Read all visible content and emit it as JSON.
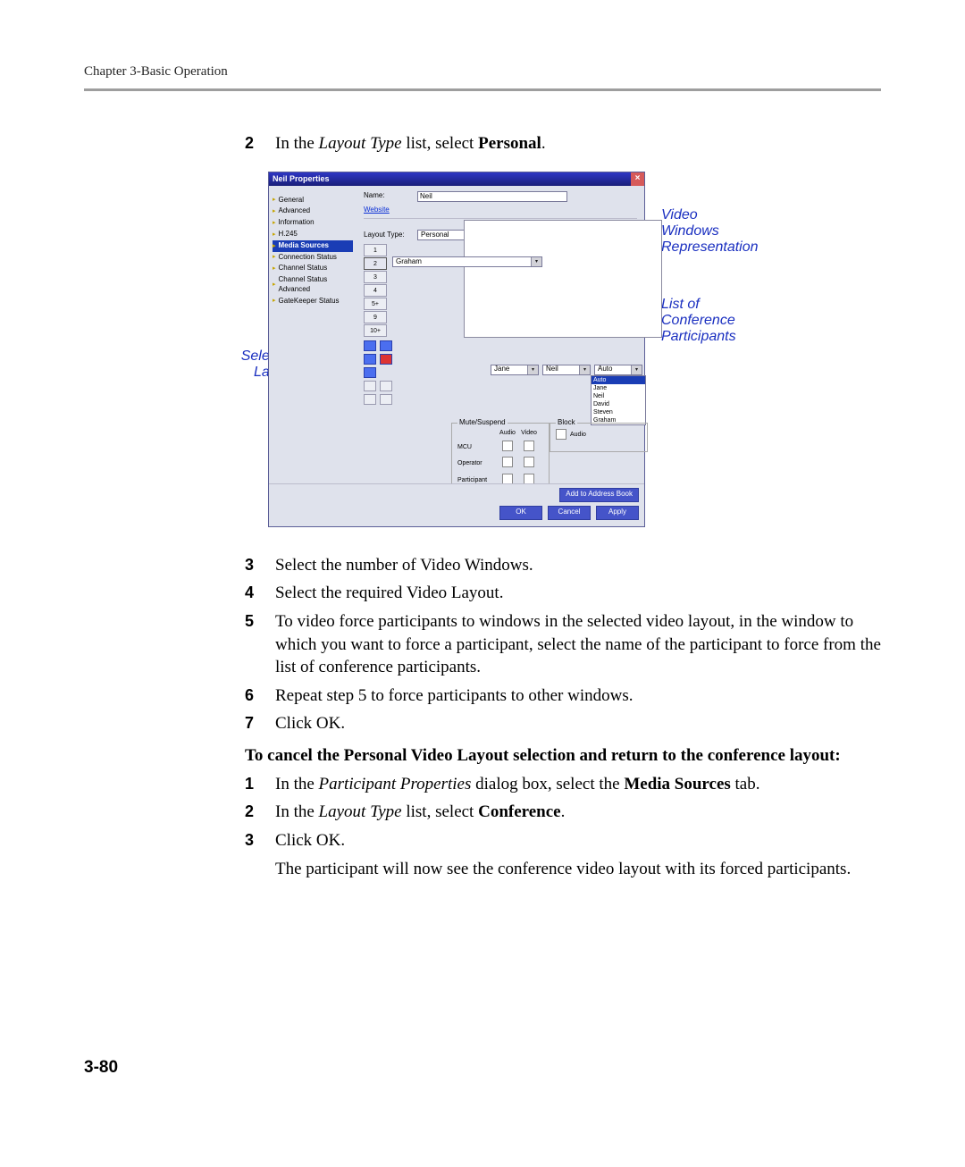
{
  "header": "Chapter 3-Basic Operation",
  "page_number": "3-80",
  "steps_a": [
    {
      "n": "2",
      "parts": [
        {
          "t": "In the "
        },
        {
          "t": "Layout Type",
          "cls": "it"
        },
        {
          "t": " list, select "
        },
        {
          "t": "Personal",
          "cls": "bd"
        },
        {
          "t": "."
        }
      ]
    }
  ],
  "steps_b": [
    {
      "n": "3",
      "parts": [
        {
          "t": "Select the number of Video Windows."
        }
      ]
    },
    {
      "n": "4",
      "parts": [
        {
          "t": "Select the required Video Layout."
        }
      ]
    },
    {
      "n": "5",
      "parts": [
        {
          "t": "To video force participants to windows in the selected video layout, in the window to which you want to force a participant, select the name of the participant to force from the list of conference participants."
        }
      ]
    },
    {
      "n": "6",
      "parts": [
        {
          "t": "Repeat step 5 to force participants to other windows."
        }
      ]
    },
    {
      "n": "7",
      "parts": [
        {
          "t": "Click OK."
        }
      ]
    }
  ],
  "subhead": "To cancel the Personal Video Layout selection and return to the conference layout:",
  "steps_c": [
    {
      "n": "1",
      "parts": [
        {
          "t": "In the "
        },
        {
          "t": "Participant Properties",
          "cls": "it"
        },
        {
          "t": " dialog box, select the "
        },
        {
          "t": "Media Sources",
          "cls": "bd"
        },
        {
          "t": " tab."
        }
      ]
    },
    {
      "n": "2",
      "parts": [
        {
          "t": "In the "
        },
        {
          "t": "Layout Type",
          "cls": "it"
        },
        {
          "t": " list, select "
        },
        {
          "t": "Conference",
          "cls": "bd"
        },
        {
          "t": "."
        }
      ]
    },
    {
      "n": "3",
      "parts": [
        {
          "t": "Click OK."
        }
      ]
    }
  ],
  "tail": "The participant will now see the conference video layout with its forced participants.",
  "annotations": {
    "selected_layout": "Selected Layout",
    "video_windows": "Video Windows Representation",
    "participants": "List of Conference Participants"
  },
  "dialog": {
    "title": "Neil Properties",
    "close": "×",
    "tree": [
      "General",
      "Advanced",
      "Information",
      "H.245",
      "Media Sources",
      "Connection Status",
      "Channel Status",
      "Channel Status Advanced",
      "GateKeeper Status"
    ],
    "tree_selected": 4,
    "name_label": "Name:",
    "name_value": "Neil",
    "website": "Website",
    "layout_type_label": "Layout Type:",
    "layout_type_value": "Personal",
    "num_buttons": [
      "1",
      "2",
      "3",
      "4",
      "5+",
      "9",
      "10+"
    ],
    "row2_value": "Graham",
    "mid_selects": [
      "Jane",
      "Neil",
      "Auto"
    ],
    "participants": [
      "Auto",
      "Jane",
      "Neil",
      "David",
      "Steven",
      "Graham"
    ],
    "mute_legend": "Mute/Suspend",
    "block_legend": "Block",
    "col_audio": "Audio",
    "col_video": "Video",
    "rows": [
      "MCU",
      "Operator",
      "Participant"
    ],
    "block_audio": "Audio",
    "add_btn": "Add to Address Book",
    "ok": "OK",
    "cancel": "Cancel",
    "apply": "Apply"
  }
}
